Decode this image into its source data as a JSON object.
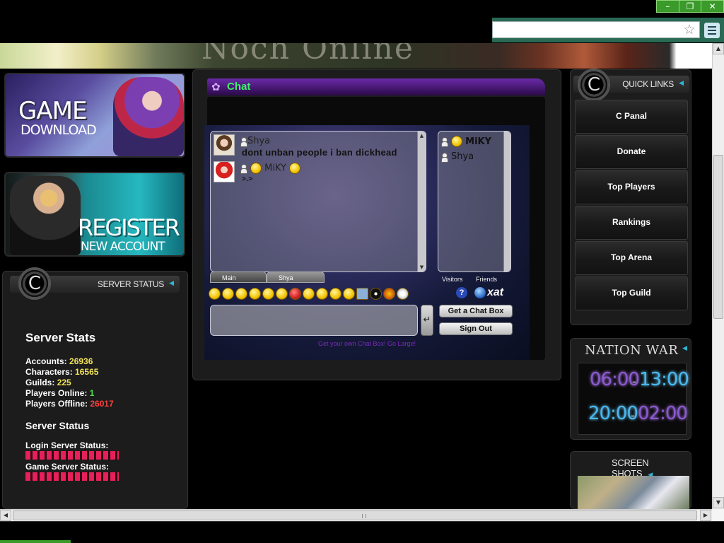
{
  "browser": {
    "window_controls": [
      "–",
      "❐",
      "✕"
    ],
    "star_icon": "star-icon",
    "menu_icon": "menu-icon"
  },
  "banner": {
    "logo_text": "Noch Online"
  },
  "left": {
    "game_download": {
      "line1": "GAME",
      "line2": "DOWNLOAD"
    },
    "register": {
      "line1": "REGISTER",
      "line2": "NEW ACCOUNT"
    },
    "server_status": {
      "header": "SERVER STATUS",
      "emblem": "C",
      "stats_title": "Server Stats",
      "stats": [
        {
          "label": "Accounts:",
          "value": "26936",
          "color": "yellow"
        },
        {
          "label": "Characters:",
          "value": "16565",
          "color": "yellow"
        },
        {
          "label": "Guilds:",
          "value": "225",
          "color": "yellow"
        },
        {
          "label": "Players Online:",
          "value": "1",
          "color": "green"
        },
        {
          "label": "Players Offline:",
          "value": "26017",
          "color": "red"
        }
      ],
      "status_title": "Server Status",
      "login_label": "Login Server Status:",
      "game_label": "Game Server Status:"
    }
  },
  "chat": {
    "tab_label": "Chat",
    "messages": [
      {
        "user": "Shya",
        "text": "dont unban people i ban dickhead"
      },
      {
        "user": "MiKY",
        "text": ">.>"
      }
    ],
    "tabs": {
      "main": "Main",
      "private": "Shya"
    },
    "users": [
      "MiKY",
      "Shya"
    ],
    "user_tabs": {
      "visitors": "Visitors",
      "friends": "Friends"
    },
    "send_symbol": "↵",
    "buttons": {
      "get_chat_box": "Get a Chat Box",
      "sign_out": "Sign Out"
    },
    "xat_label": "xat",
    "help_symbol": "?",
    "promo": "Get your own Chat Box! Go Large!"
  },
  "right": {
    "quick_links": {
      "header": "QUICK LINKS",
      "emblem": "C",
      "items": [
        "C Panal",
        "Donate",
        "Top Players",
        "Rankings",
        "Top Arena",
        "Top Guild"
      ]
    },
    "nation_war": {
      "title": "NATION WAR",
      "times": [
        "06:00",
        "13:00",
        "20:00",
        "02:00"
      ],
      "dash": "-"
    },
    "screen_shots": {
      "title": "SCREEN SHOTS"
    }
  },
  "colors": {
    "accent_cyan": "#2ab8d8",
    "chat_green": "#3ef06a",
    "stat_yellow": "#f2e35a",
    "stat_green": "#4ee04e",
    "stat_red": "#ff4040",
    "led_red": "#e8205a"
  }
}
